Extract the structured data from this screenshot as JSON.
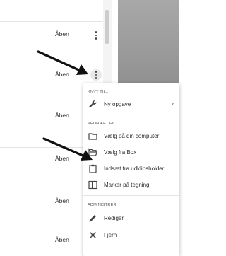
{
  "rows": [
    {
      "status": "Åben"
    },
    {
      "status": "Åben"
    },
    {
      "status": "Åben"
    },
    {
      "status": "Åben"
    },
    {
      "status": "Åben"
    },
    {
      "status": "Åben"
    }
  ],
  "menu": {
    "link_section": "KNYT TIL...",
    "new_task": "Ny opgave",
    "attach_section": "VEDHÆFT FIL",
    "choose_computer": "Vælg på din computer",
    "choose_box": "Vælg fra Box",
    "paste_clipboard": "Indsæt fra udklipsholder",
    "mark_drawing": "Marker på tegning",
    "admin_section": "ADMINISTRÉR",
    "edit": "Rediger",
    "remove": "Fjern"
  },
  "icons": {
    "new_task": "wrench-icon",
    "choose_computer": "folder-icon",
    "choose_box": "open-folder-icon",
    "paste_clipboard": "clipboard-icon",
    "mark_drawing": "drawing-grid-icon",
    "edit": "pencil-icon",
    "remove": "close-icon",
    "submenu": "chevron-right-icon"
  },
  "colors": {
    "annotation_arrow": "#111111",
    "menu_background": "#ffffff",
    "active_kebab": "#e8e8e8"
  }
}
